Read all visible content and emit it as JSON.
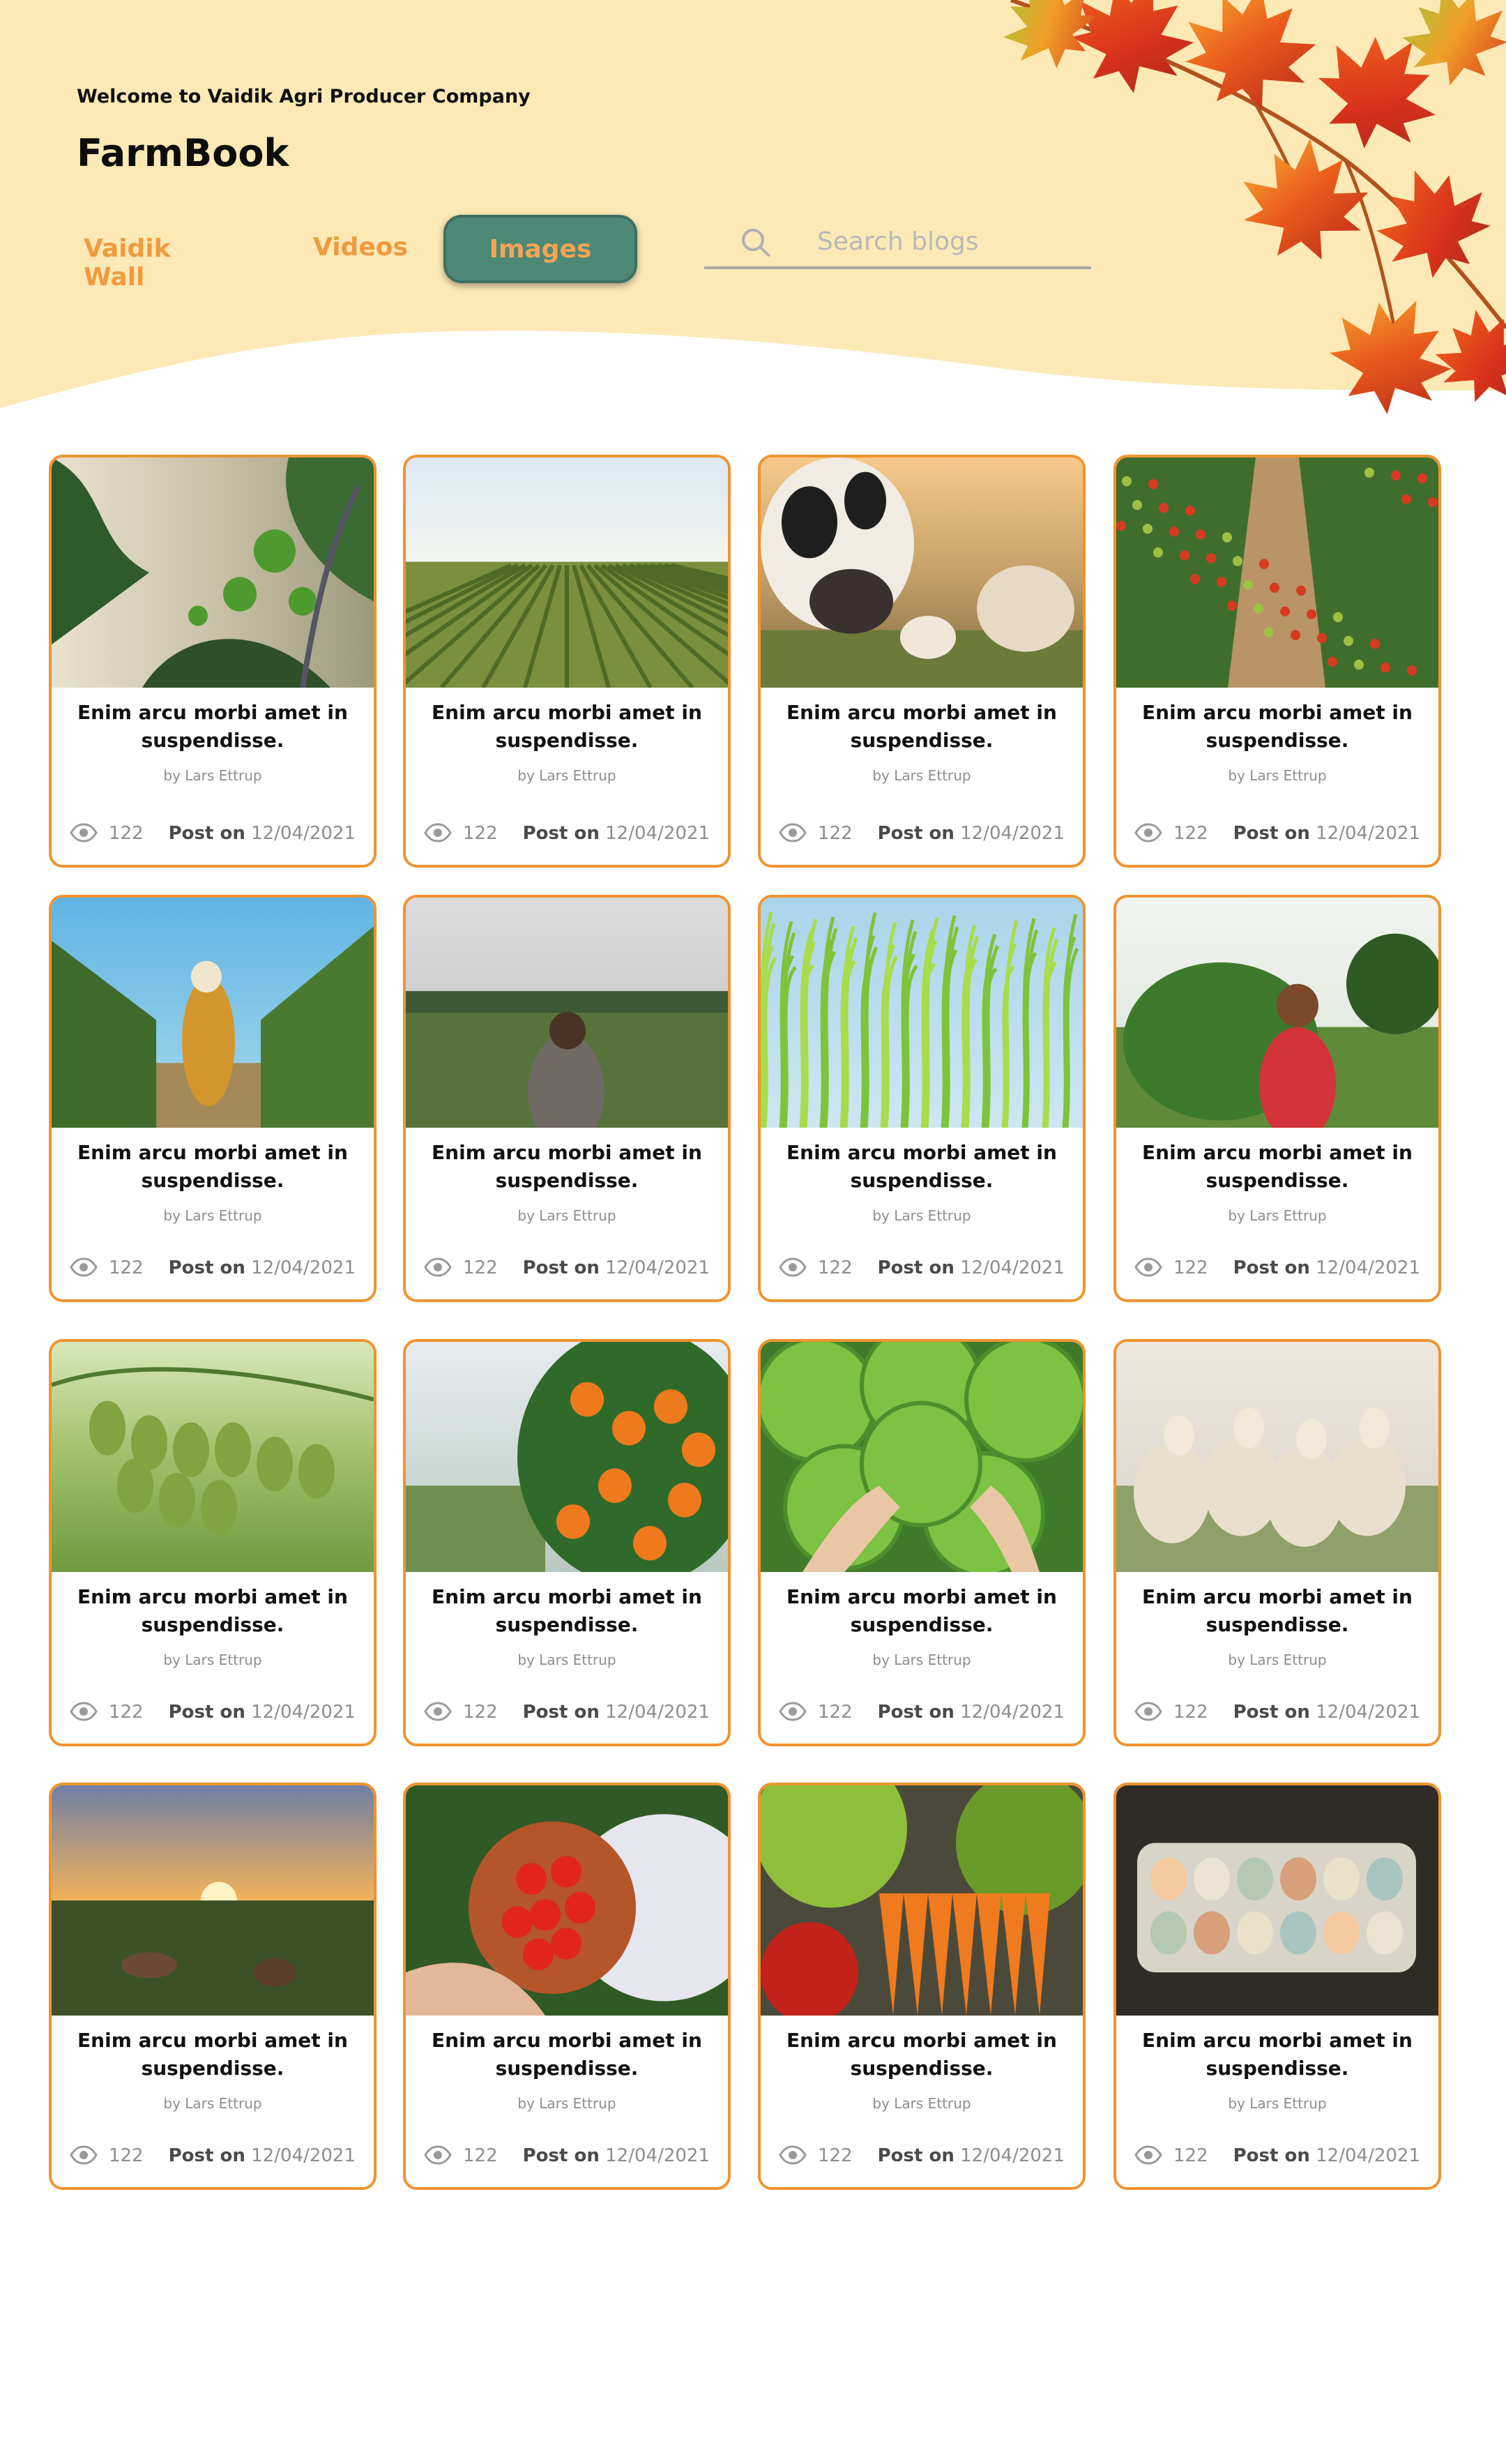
{
  "header": {
    "welcome": "Welcome to Vaidik Agri Producer Company",
    "brand": "FarmBook",
    "colors": {
      "background": "#fde9b6",
      "accent": "#f09a3e",
      "active_tab": "#4e8877"
    }
  },
  "tabs": [
    {
      "label": "Vaidik Wall",
      "active": false
    },
    {
      "label": "Videos",
      "active": false
    },
    {
      "label": "Images",
      "active": true
    }
  ],
  "search": {
    "placeholder": "Search blogs",
    "icon": "search-icon"
  },
  "cards": [
    {
      "title": "Enim arcu morbi amet in suspendisse.",
      "author": "by Lars Ettrup",
      "views": "122",
      "post_label": "Post on",
      "date": "12/04/2021",
      "image": "tomato-vine"
    },
    {
      "title": "Enim arcu morbi amet in suspendisse.",
      "author": "by Lars Ettrup",
      "views": "122",
      "post_label": "Post on",
      "date": "12/04/2021",
      "image": "crop-field"
    },
    {
      "title": "Enim arcu morbi amet in suspendisse.",
      "author": "by Lars Ettrup",
      "views": "122",
      "post_label": "Post on",
      "date": "12/04/2021",
      "image": "cows"
    },
    {
      "title": "Enim arcu morbi amet in suspendisse.",
      "author": "by Lars Ettrup",
      "views": "122",
      "post_label": "Post on",
      "date": "12/04/2021",
      "image": "greenhouse-rows"
    },
    {
      "title": "Enim arcu morbi amet in suspendisse.",
      "author": "by Lars Ettrup",
      "views": "122",
      "post_label": "Post on",
      "date": "12/04/2021",
      "image": "vineyard-woman"
    },
    {
      "title": "Enim arcu morbi amet in suspendisse.",
      "author": "by Lars Ettrup",
      "views": "122",
      "post_label": "Post on",
      "date": "12/04/2021",
      "image": "corn-field"
    },
    {
      "title": "Enim arcu morbi amet in suspendisse.",
      "author": "by Lars Ettrup",
      "views": "122",
      "post_label": "Post on",
      "date": "12/04/2021",
      "image": "rice-paddy"
    },
    {
      "title": "Enim arcu morbi amet in suspendisse.",
      "author": "by Lars Ettrup",
      "views": "122",
      "post_label": "Post on",
      "date": "12/04/2021",
      "image": "farmer-woman"
    },
    {
      "title": "Enim arcu morbi amet in suspendisse.",
      "author": "by Lars Ettrup",
      "views": "122",
      "post_label": "Post on",
      "date": "12/04/2021",
      "image": "green-tomatoes"
    },
    {
      "title": "Enim arcu morbi amet in suspendisse.",
      "author": "by Lars Ettrup",
      "views": "122",
      "post_label": "Post on",
      "date": "12/04/2021",
      "image": "orange-tree"
    },
    {
      "title": "Enim arcu morbi amet in suspendisse.",
      "author": "by Lars Ettrup",
      "views": "122",
      "post_label": "Post on",
      "date": "12/04/2021",
      "image": "lettuce"
    },
    {
      "title": "Enim arcu morbi amet in suspendisse.",
      "author": "by Lars Ettrup",
      "views": "122",
      "post_label": "Post on",
      "date": "12/04/2021",
      "image": "sheep"
    },
    {
      "title": "Enim arcu morbi amet in suspendisse.",
      "author": "by Lars Ettrup",
      "views": "122",
      "post_label": "Post on",
      "date": "12/04/2021",
      "image": "sunset-horses"
    },
    {
      "title": "Enim arcu morbi amet in suspendisse.",
      "author": "by Lars Ettrup",
      "views": "122",
      "post_label": "Post on",
      "date": "12/04/2021",
      "image": "tomato-bowl"
    },
    {
      "title": "Enim arcu morbi amet in suspendisse.",
      "author": "by Lars Ettrup",
      "views": "122",
      "post_label": "Post on",
      "date": "12/04/2021",
      "image": "vegetables"
    },
    {
      "title": "Enim arcu morbi amet in suspendisse.",
      "author": "by Lars Ettrup",
      "views": "122",
      "post_label": "Post on",
      "date": "12/04/2021",
      "image": "eggs"
    }
  ]
}
